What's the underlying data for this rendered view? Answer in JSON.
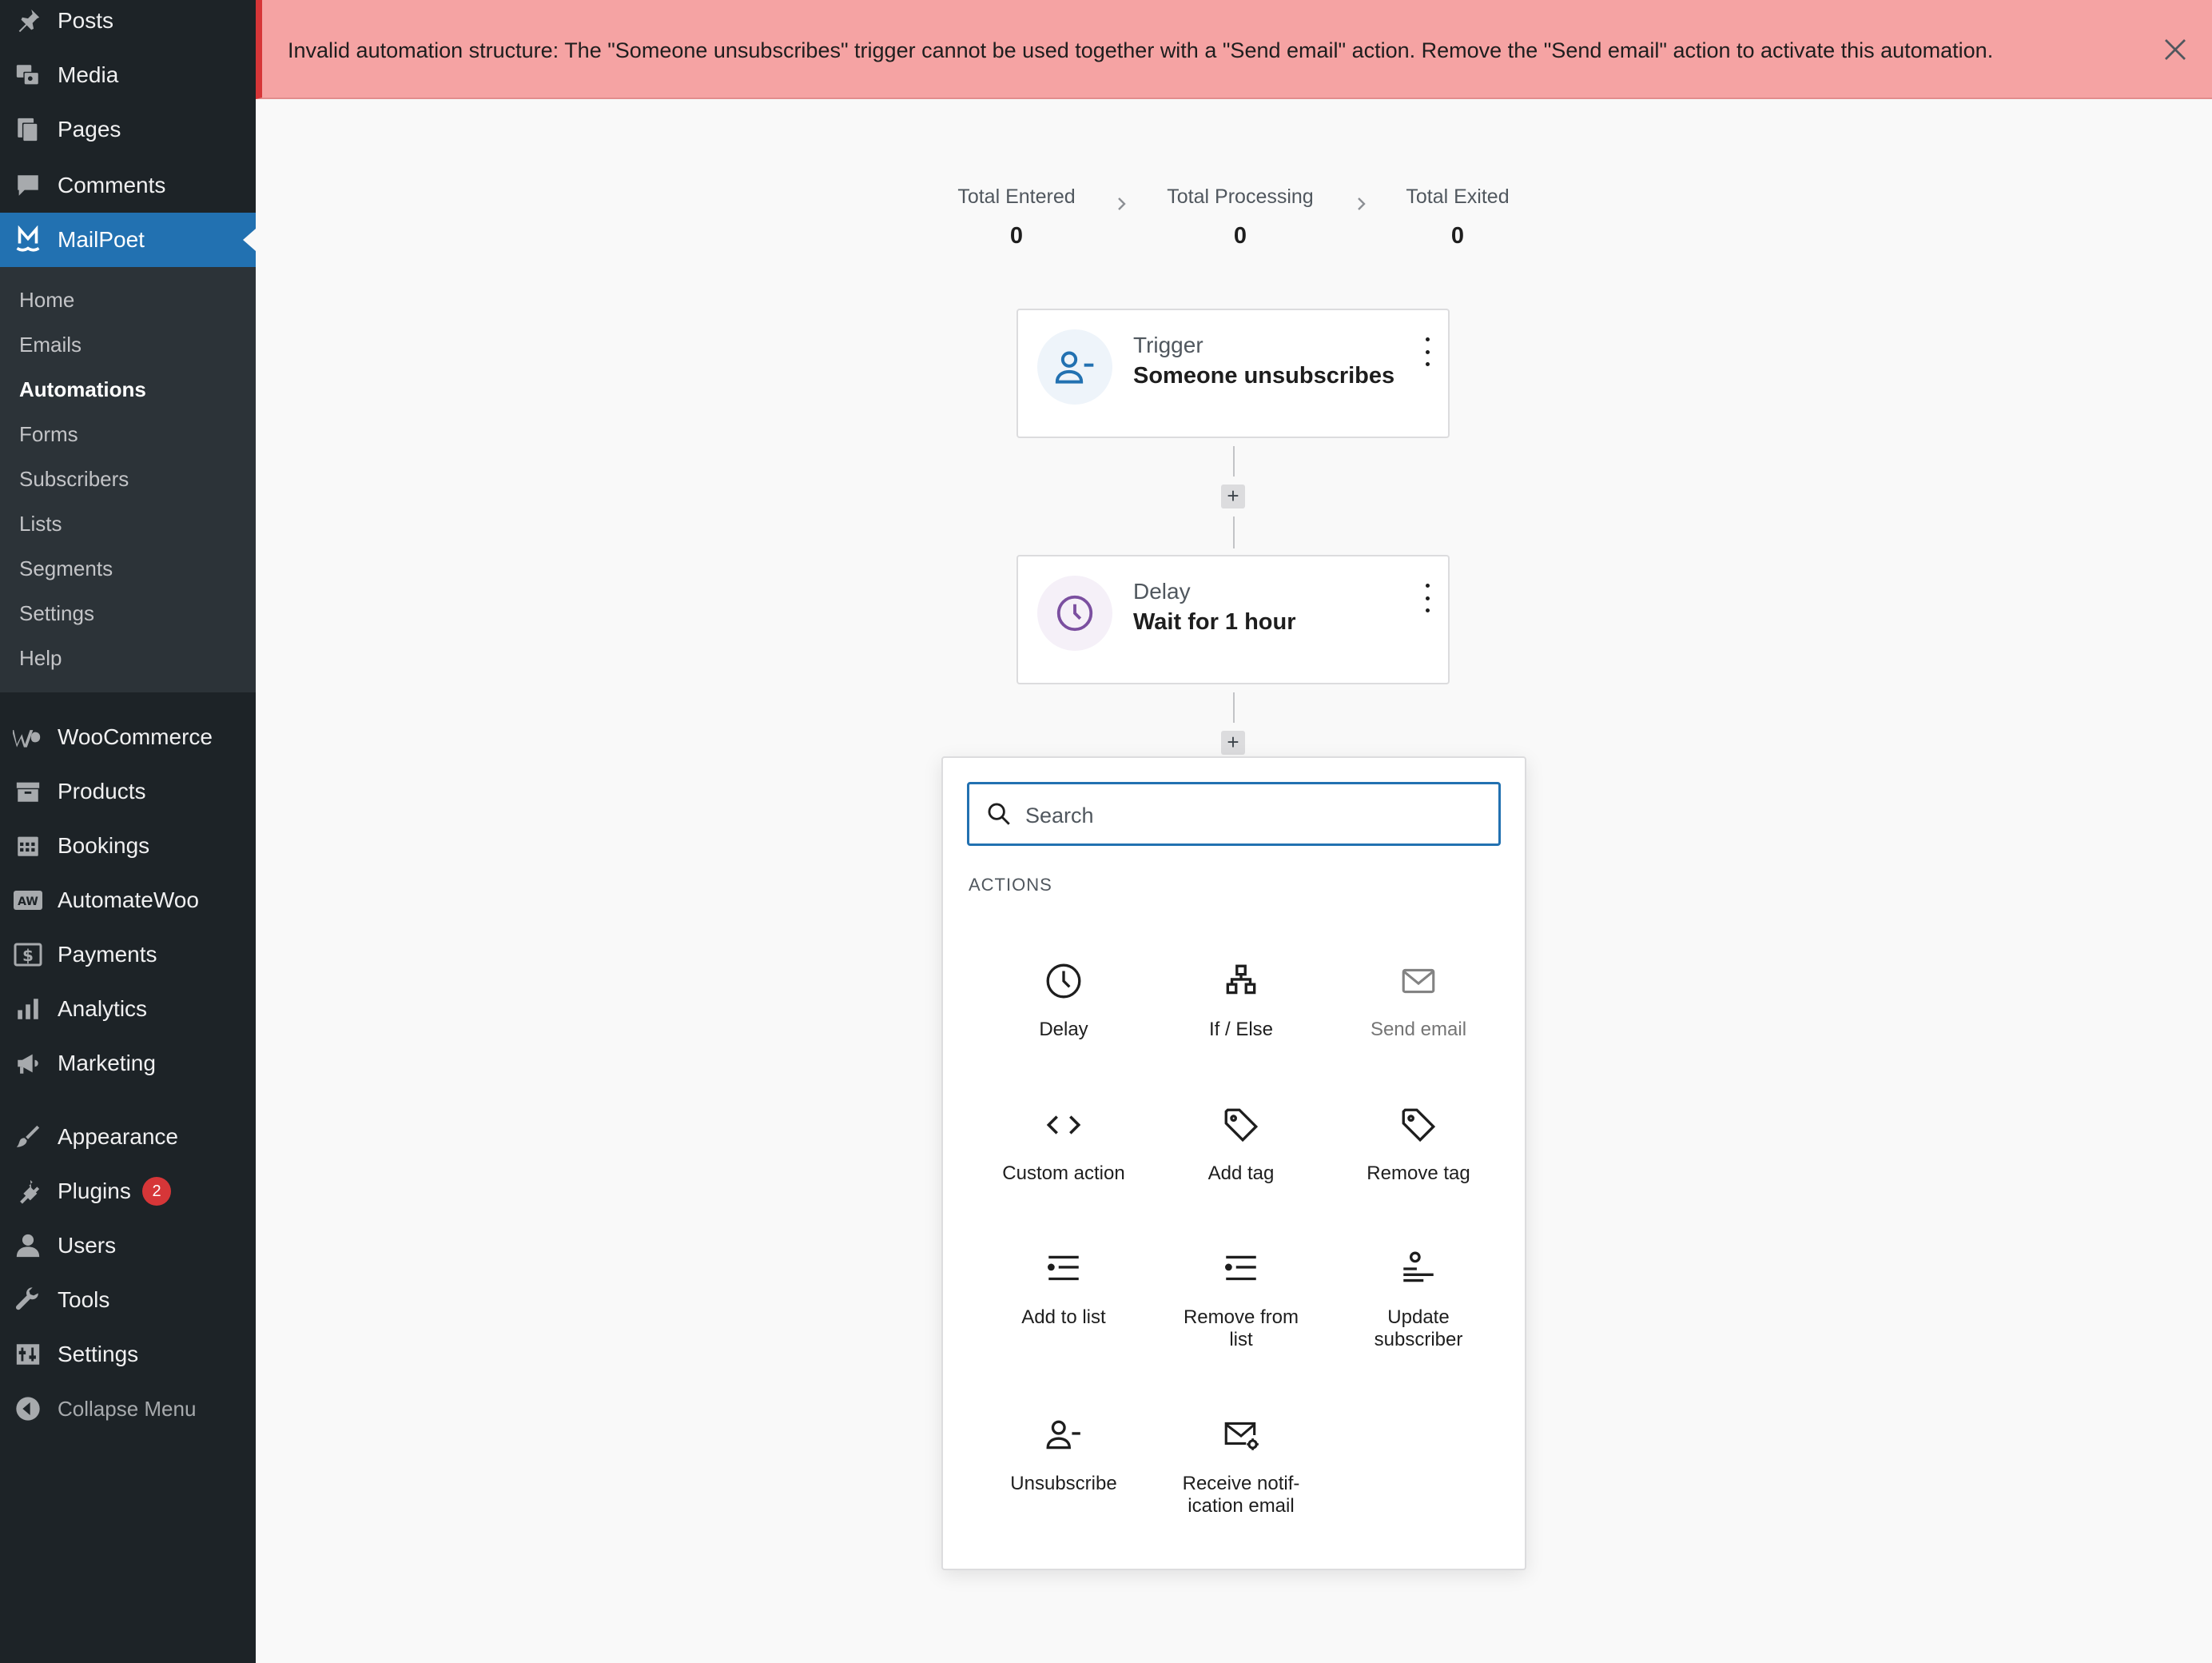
{
  "notice": {
    "message": "Invalid automation structure: The \"Someone unsubscribes\" trigger cannot be used together with a \"Send email\" action. Remove the \"Send email\" action to activate this automation.",
    "close_icon": "close-icon",
    "color": "#f5a3a3"
  },
  "sidebar": {
    "top_items": [
      {
        "label": "Posts",
        "icon": "pin-icon"
      },
      {
        "label": "Media",
        "icon": "media-icon"
      },
      {
        "label": "Pages",
        "icon": "pages-icon"
      },
      {
        "label": "Comments",
        "icon": "comment-icon"
      },
      {
        "label": "MailPoet",
        "icon": "mailpoet-icon",
        "active": true
      }
    ],
    "submenu": [
      "Home",
      "Emails",
      "Automations",
      "Forms",
      "Subscribers",
      "Lists",
      "Segments",
      "Settings",
      "Help"
    ],
    "current_submenu": "Automations",
    "bottom_items": [
      {
        "label": "WooCommerce",
        "icon": "woo-icon"
      },
      {
        "label": "Products",
        "icon": "archive-icon"
      },
      {
        "label": "Bookings",
        "icon": "calendar-icon"
      },
      {
        "label": "AutomateWoo",
        "icon": "aw-icon"
      },
      {
        "label": "Payments",
        "icon": "dollar-icon"
      },
      {
        "label": "Analytics",
        "icon": "chart-icon"
      },
      {
        "label": "Marketing",
        "icon": "megaphone-icon"
      },
      {
        "label": "Appearance",
        "icon": "brush-icon"
      },
      {
        "label": "Plugins",
        "icon": "plug-icon",
        "badge": "2"
      },
      {
        "label": "Users",
        "icon": "user-icon"
      },
      {
        "label": "Tools",
        "icon": "wrench-icon"
      },
      {
        "label": "Settings",
        "icon": "settings-icon"
      }
    ],
    "collapse_label": "Collapse Menu",
    "accent_color": "#2271b1"
  },
  "stats": [
    {
      "label": "Total Entered",
      "value": "0"
    },
    {
      "label": "Total Processing",
      "value": "0"
    },
    {
      "label": "Total Exited",
      "value": "0"
    }
  ],
  "steps": {
    "trigger": {
      "type": "Trigger",
      "name": "Someone unsubscribes",
      "icon": "user-minus-icon"
    },
    "delay": {
      "type": "Delay",
      "name": "Wait for 1 hour",
      "icon": "clock-icon"
    }
  },
  "inserter": {
    "search_placeholder": "Search",
    "heading": "ACTIONS",
    "actions": [
      {
        "label": "Delay",
        "icon": "clock-icon"
      },
      {
        "label": "If / Else",
        "icon": "branch-icon"
      },
      {
        "label": "Send email",
        "icon": "envelope-icon",
        "disabled": true
      },
      {
        "label": "Custom action",
        "icon": "code-icon"
      },
      {
        "label": "Add tag",
        "icon": "tag-icon"
      },
      {
        "label": "Remove tag",
        "icon": "tag-icon"
      },
      {
        "label": "Add to list",
        "icon": "list-icon"
      },
      {
        "label": "Remove from list",
        "icon": "list-icon"
      },
      {
        "label": "Update subscriber",
        "icon": "update-subscriber-icon"
      },
      {
        "label": "Unsubscribe",
        "icon": "user-minus-icon"
      },
      {
        "label": "Receive notif-ication email",
        "icon": "envelope-gear-icon"
      }
    ]
  }
}
